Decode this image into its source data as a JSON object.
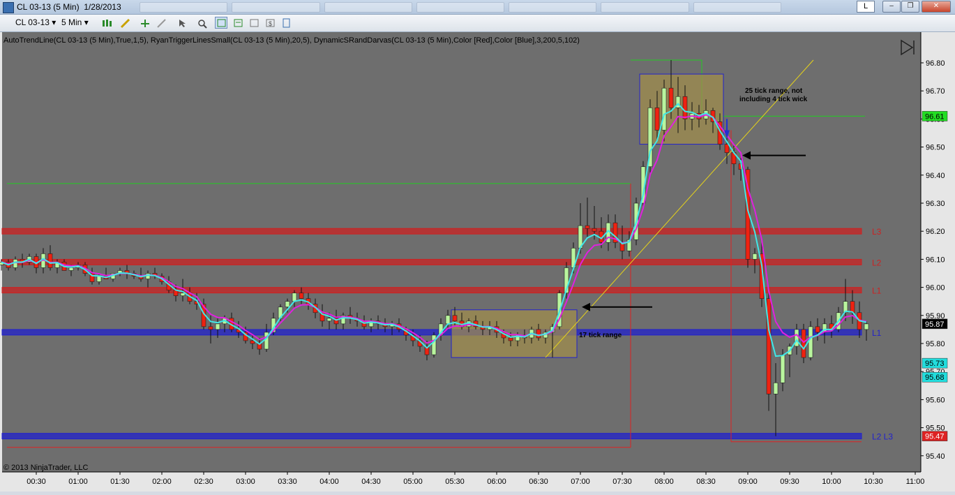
{
  "window": {
    "title": "CL 03-13 (5 Min)  1/28/2013",
    "l_button": "L",
    "minimize": "‒",
    "restore": "❐",
    "close": "✕"
  },
  "toolbar": {
    "instrument": "CL 03-13",
    "interval": "5 Min"
  },
  "indicator_label": "AutoTrendLine(CL 03-13 (5 Min),True,1,5), RyanTriggerLinesSmall(CL 03-13 (5 Min),20,5), DynamicSRandDarvas(CL 03-13 (5 Min),Color [Red],Color [Blue],3,200,5,102)",
  "copyright": "© 2013 NinjaTrader, LLC",
  "annotations": {
    "tick25": "25 tick range, not",
    "tick25b": "including 4 tick wick",
    "tick17": "17 tick range"
  },
  "chart_data": {
    "type": "candlestick",
    "instrument": "CL 03-13",
    "interval": "5 Min",
    "date": "1/28/2013",
    "ylim": [
      95.36,
      96.86
    ],
    "y_ticks": [
      "96.80",
      "96.70",
      "96.60",
      "96.50",
      "96.40",
      "96.30",
      "96.20",
      "96.10",
      "96.00",
      "95.90",
      "95.80",
      "95.70",
      "95.60",
      "95.50",
      "95.40"
    ],
    "x_ticks": [
      "00:30",
      "01:00",
      "01:30",
      "02:00",
      "02:30",
      "03:00",
      "03:30",
      "04:00",
      "04:30",
      "05:00",
      "05:30",
      "06:00",
      "06:30",
      "07:00",
      "07:30",
      "08:00",
      "08:30",
      "09:00",
      "09:30",
      "10:00",
      "10:30",
      "11:00"
    ],
    "price_tags": [
      {
        "label": "96.61",
        "value": 96.61,
        "bg": "#22dd22",
        "fg": "#000000"
      },
      {
        "label": "95.87",
        "value": 95.87,
        "bg": "#000000",
        "fg": "#ffffff"
      },
      {
        "label": "95.73",
        "value": 95.73,
        "bg": "#22dddd",
        "fg": "#000000"
      },
      {
        "label": "95.68",
        "value": 95.68,
        "bg": "#22dddd",
        "fg": "#000000"
      },
      {
        "label": "95.47",
        "value": 95.47,
        "bg": "#dd2222",
        "fg": "#ffffff"
      }
    ],
    "levels": [
      {
        "label": "L3",
        "value": 96.2,
        "color": "#cc2222"
      },
      {
        "label": "L2",
        "value": 96.09,
        "color": "#cc2222"
      },
      {
        "label": "L1",
        "value": 95.99,
        "color": "#cc2222"
      },
      {
        "label": "L1",
        "value": 95.84,
        "color": "#2222cc"
      },
      {
        "label": "L2 L3",
        "value": 95.47,
        "color": "#2222cc"
      }
    ],
    "boxes": [
      {
        "t0": "05:30",
        "t1": "06:55",
        "high": 95.92,
        "low": 95.75,
        "label": "17 tick range"
      },
      {
        "t0": "07:45",
        "t1": "08:40",
        "high": 96.76,
        "low": 96.51,
        "label": "25 tick range, not including 4 tick wick"
      }
    ],
    "candles": [
      [
        "00:05",
        96.08,
        96.1,
        96.06,
        96.09
      ],
      [
        "00:10",
        96.09,
        96.1,
        96.06,
        96.07
      ],
      [
        "00:15",
        96.07,
        96.11,
        96.06,
        96.1
      ],
      [
        "00:20",
        96.1,
        96.12,
        96.07,
        96.09
      ],
      [
        "00:25",
        96.09,
        96.12,
        96.08,
        96.11
      ],
      [
        "00:30",
        96.11,
        96.12,
        96.05,
        96.07
      ],
      [
        "00:35",
        96.07,
        96.14,
        96.05,
        96.12
      ],
      [
        "00:40",
        96.12,
        96.15,
        96.06,
        96.07
      ],
      [
        "00:45",
        96.07,
        96.1,
        96.05,
        96.09
      ],
      [
        "00:50",
        96.09,
        96.1,
        96.06,
        96.06
      ],
      [
        "00:55",
        96.06,
        96.08,
        96.04,
        96.07
      ],
      [
        "01:00",
        96.07,
        96.09,
        96.06,
        96.08
      ],
      [
        "01:05",
        96.08,
        96.09,
        96.04,
        96.05
      ],
      [
        "01:10",
        96.05,
        96.07,
        96.01,
        96.02
      ],
      [
        "01:15",
        96.02,
        96.05,
        96.01,
        96.04
      ],
      [
        "01:20",
        96.04,
        96.07,
        96.03,
        96.03
      ],
      [
        "01:25",
        96.03,
        96.05,
        96.02,
        96.05
      ],
      [
        "01:30",
        96.05,
        96.07,
        96.04,
        96.06
      ],
      [
        "01:35",
        96.06,
        96.08,
        96.03,
        96.05
      ],
      [
        "01:40",
        96.05,
        96.06,
        96.03,
        96.04
      ],
      [
        "01:45",
        96.04,
        96.07,
        96.02,
        96.03
      ],
      [
        "01:50",
        96.03,
        96.06,
        96.0,
        96.05
      ],
      [
        "01:55",
        96.05,
        96.07,
        96.03,
        96.04
      ],
      [
        "02:00",
        96.04,
        96.05,
        96.01,
        96.02
      ],
      [
        "02:05",
        96.02,
        96.04,
        95.98,
        95.99
      ],
      [
        "02:10",
        95.99,
        96.01,
        95.95,
        95.97
      ],
      [
        "02:15",
        95.97,
        96.03,
        95.95,
        95.98
      ],
      [
        "02:20",
        95.98,
        96.0,
        95.94,
        95.95
      ],
      [
        "02:25",
        95.95,
        95.98,
        95.92,
        95.94
      ],
      [
        "02:30",
        95.94,
        95.96,
        95.85,
        95.86
      ],
      [
        "02:35",
        95.86,
        95.9,
        95.8,
        95.85
      ],
      [
        "02:40",
        95.85,
        95.89,
        95.82,
        95.87
      ],
      [
        "02:45",
        95.87,
        95.9,
        95.84,
        95.89
      ],
      [
        "02:50",
        95.89,
        95.91,
        95.84,
        95.85
      ],
      [
        "02:55",
        95.85,
        95.88,
        95.82,
        95.84
      ],
      [
        "03:00",
        95.84,
        95.86,
        95.8,
        95.81
      ],
      [
        "03:05",
        95.81,
        95.83,
        95.78,
        95.8
      ],
      [
        "03:10",
        95.8,
        95.82,
        95.76,
        95.78
      ],
      [
        "03:15",
        95.78,
        95.87,
        95.77,
        95.84
      ],
      [
        "03:20",
        95.84,
        95.91,
        95.83,
        95.89
      ],
      [
        "03:25",
        95.89,
        95.94,
        95.88,
        95.93
      ],
      [
        "03:30",
        95.93,
        95.96,
        95.91,
        95.95
      ],
      [
        "03:35",
        95.95,
        95.99,
        95.93,
        95.98
      ],
      [
        "03:40",
        95.98,
        96.0,
        95.94,
        95.96
      ],
      [
        "03:45",
        95.96,
        95.98,
        95.92,
        95.94
      ],
      [
        "03:50",
        95.94,
        95.96,
        95.89,
        95.91
      ],
      [
        "03:55",
        95.91,
        95.94,
        95.86,
        95.88
      ],
      [
        "04:00",
        95.88,
        95.91,
        95.85,
        95.89
      ],
      [
        "04:05",
        95.89,
        95.92,
        95.85,
        95.87
      ],
      [
        "04:10",
        95.87,
        95.91,
        95.85,
        95.9
      ],
      [
        "04:15",
        95.9,
        95.93,
        95.87,
        95.89
      ],
      [
        "04:20",
        95.89,
        95.91,
        95.86,
        95.88
      ],
      [
        "04:25",
        95.88,
        95.9,
        95.85,
        95.86
      ],
      [
        "04:30",
        95.86,
        95.89,
        95.84,
        95.88
      ],
      [
        "04:35",
        95.88,
        95.9,
        95.85,
        95.87
      ],
      [
        "04:40",
        95.87,
        95.89,
        95.84,
        95.86
      ],
      [
        "04:45",
        95.86,
        95.88,
        95.83,
        95.87
      ],
      [
        "04:50",
        95.87,
        95.89,
        95.84,
        95.85
      ],
      [
        "04:55",
        95.85,
        95.86,
        95.81,
        95.83
      ],
      [
        "05:00",
        95.83,
        95.85,
        95.79,
        95.81
      ],
      [
        "05:05",
        95.81,
        95.83,
        95.77,
        95.79
      ],
      [
        "05:10",
        95.79,
        95.81,
        95.74,
        95.76
      ],
      [
        "05:15",
        95.76,
        95.84,
        95.75,
        95.83
      ],
      [
        "05:20",
        95.83,
        95.89,
        95.81,
        95.87
      ],
      [
        "05:25",
        95.87,
        95.92,
        95.85,
        95.9
      ],
      [
        "05:30",
        95.9,
        95.93,
        95.86,
        95.88
      ],
      [
        "05:35",
        95.88,
        95.91,
        95.85,
        95.86
      ],
      [
        "05:40",
        95.86,
        95.89,
        95.84,
        95.88
      ],
      [
        "05:45",
        95.88,
        95.9,
        95.85,
        95.86
      ],
      [
        "05:50",
        95.86,
        95.88,
        95.83,
        95.85
      ],
      [
        "05:55",
        95.85,
        95.88,
        95.83,
        95.86
      ],
      [
        "06:00",
        95.86,
        95.88,
        95.82,
        95.84
      ],
      [
        "06:05",
        95.84,
        95.85,
        95.8,
        95.82
      ],
      [
        "06:10",
        95.82,
        95.84,
        95.79,
        95.81
      ],
      [
        "06:15",
        95.81,
        95.84,
        95.79,
        95.83
      ],
      [
        "06:20",
        95.83,
        95.85,
        95.8,
        95.82
      ],
      [
        "06:25",
        95.82,
        95.86,
        95.8,
        95.85
      ],
      [
        "06:30",
        95.85,
        95.87,
        95.81,
        95.82
      ],
      [
        "06:35",
        95.82,
        95.85,
        95.8,
        95.84
      ],
      [
        "06:40",
        95.84,
        95.87,
        95.75,
        95.86
      ],
      [
        "06:45",
        95.86,
        95.99,
        95.85,
        95.98
      ],
      [
        "06:50",
        95.98,
        96.09,
        95.96,
        96.07
      ],
      [
        "06:55",
        96.07,
        96.16,
        96.05,
        96.14
      ],
      [
        "07:00",
        96.14,
        96.3,
        96.12,
        96.22
      ],
      [
        "07:05",
        96.22,
        96.32,
        96.18,
        96.21
      ],
      [
        "07:10",
        96.21,
        96.29,
        96.17,
        96.2
      ],
      [
        "07:15",
        96.2,
        96.25,
        96.14,
        96.16
      ],
      [
        "07:20",
        96.16,
        96.26,
        96.13,
        96.23
      ],
      [
        "07:25",
        96.23,
        96.26,
        96.14,
        96.16
      ],
      [
        "07:30",
        96.16,
        96.22,
        96.1,
        96.13
      ],
      [
        "07:35",
        96.13,
        96.2,
        96.11,
        96.17
      ],
      [
        "07:40",
        96.17,
        96.32,
        96.15,
        96.3
      ],
      [
        "07:45",
        96.3,
        96.45,
        96.28,
        96.43
      ],
      [
        "07:50",
        96.43,
        96.67,
        96.41,
        96.64
      ],
      [
        "07:55",
        96.64,
        96.7,
        96.52,
        96.56
      ],
      [
        "08:00",
        96.56,
        96.74,
        96.52,
        96.71
      ],
      [
        "08:05",
        96.71,
        96.81,
        96.6,
        96.64
      ],
      [
        "08:10",
        96.64,
        96.75,
        96.55,
        96.68
      ],
      [
        "08:15",
        96.68,
        96.72,
        96.56,
        96.6
      ],
      [
        "08:20",
        96.6,
        96.66,
        96.56,
        96.62
      ],
      [
        "08:25",
        96.62,
        96.65,
        96.57,
        96.6
      ],
      [
        "08:30",
        96.6,
        96.67,
        96.58,
        96.63
      ],
      [
        "08:35",
        96.63,
        96.64,
        96.55,
        96.59
      ],
      [
        "08:40",
        96.59,
        96.62,
        96.49,
        96.51
      ],
      [
        "08:45",
        96.51,
        96.54,
        96.44,
        96.48
      ],
      [
        "08:50",
        96.48,
        96.51,
        96.4,
        96.44
      ],
      [
        "08:55",
        96.44,
        96.46,
        96.38,
        96.42
      ],
      [
        "09:00",
        96.42,
        96.43,
        96.07,
        96.1
      ],
      [
        "09:05",
        96.1,
        96.14,
        96.05,
        96.12
      ],
      [
        "09:10",
        96.12,
        96.16,
        95.93,
        95.96
      ],
      [
        "09:15",
        95.96,
        95.98,
        95.56,
        95.62
      ],
      [
        "09:20",
        95.62,
        95.73,
        95.47,
        95.66
      ],
      [
        "09:25",
        95.66,
        95.78,
        95.63,
        95.76
      ],
      [
        "09:30",
        95.76,
        95.8,
        95.68,
        95.79
      ],
      [
        "09:35",
        95.79,
        95.87,
        95.76,
        95.85
      ],
      [
        "09:40",
        95.85,
        95.87,
        95.73,
        95.75
      ],
      [
        "09:45",
        95.75,
        95.88,
        95.74,
        95.86
      ],
      [
        "09:50",
        95.86,
        95.89,
        95.81,
        95.84
      ],
      [
        "09:55",
        95.84,
        95.89,
        95.8,
        95.87
      ],
      [
        "10:00",
        95.87,
        95.9,
        95.82,
        95.85
      ],
      [
        "10:05",
        95.85,
        95.93,
        95.84,
        95.91
      ],
      [
        "10:10",
        95.91,
        96.03,
        95.88,
        95.95
      ],
      [
        "10:15",
        95.95,
        95.99,
        95.87,
        95.91
      ],
      [
        "10:20",
        95.91,
        95.95,
        95.82,
        95.85
      ],
      [
        "10:25",
        95.85,
        95.88,
        95.81,
        95.87
      ]
    ]
  }
}
